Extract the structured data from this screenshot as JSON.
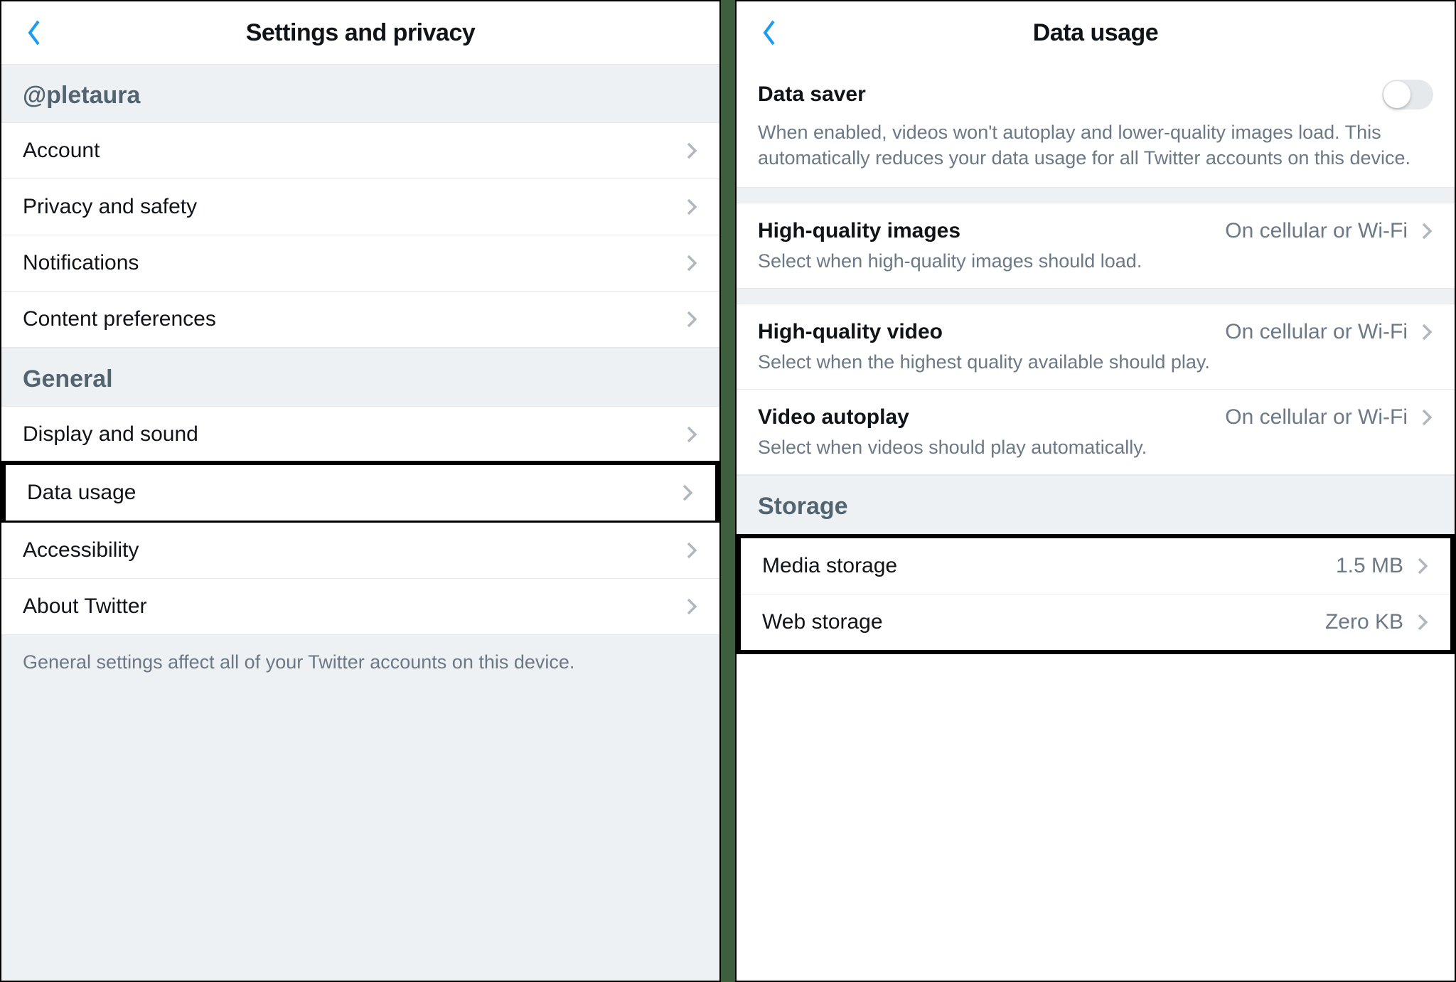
{
  "left": {
    "title": "Settings and privacy",
    "userHeader": "@pletaura",
    "rows1": [
      {
        "label": "Account"
      },
      {
        "label": "Privacy and safety"
      },
      {
        "label": "Notifications"
      },
      {
        "label": "Content preferences"
      }
    ],
    "generalHeader": "General",
    "rows2": [
      {
        "label": "Display and sound"
      },
      {
        "label": "Data usage",
        "highlighted": true
      },
      {
        "label": "Accessibility"
      },
      {
        "label": "About Twitter"
      }
    ],
    "footer": "General settings affect all of your Twitter accounts on this device."
  },
  "right": {
    "title": "Data usage",
    "dataSaverLabel": "Data saver",
    "dataSaverDesc": "When enabled, videos won't autoplay and lower-quality images load. This automatically reduces your data usage for all Twitter accounts on this device.",
    "dataSaverOn": false,
    "options": [
      {
        "label": "High-quality images",
        "value": "On cellular or Wi-Fi",
        "desc": "Select when high-quality images should load."
      },
      {
        "label": "High-quality video",
        "value": "On cellular or Wi-Fi",
        "desc": "Select when the highest quality available should play."
      },
      {
        "label": "Video autoplay",
        "value": "On cellular or Wi-Fi",
        "desc": "Select when videos should play automatically."
      }
    ],
    "storageHeader": "Storage",
    "storage": [
      {
        "label": "Media storage",
        "value": "1.5 MB"
      },
      {
        "label": "Web storage",
        "value": "Zero KB"
      }
    ]
  }
}
